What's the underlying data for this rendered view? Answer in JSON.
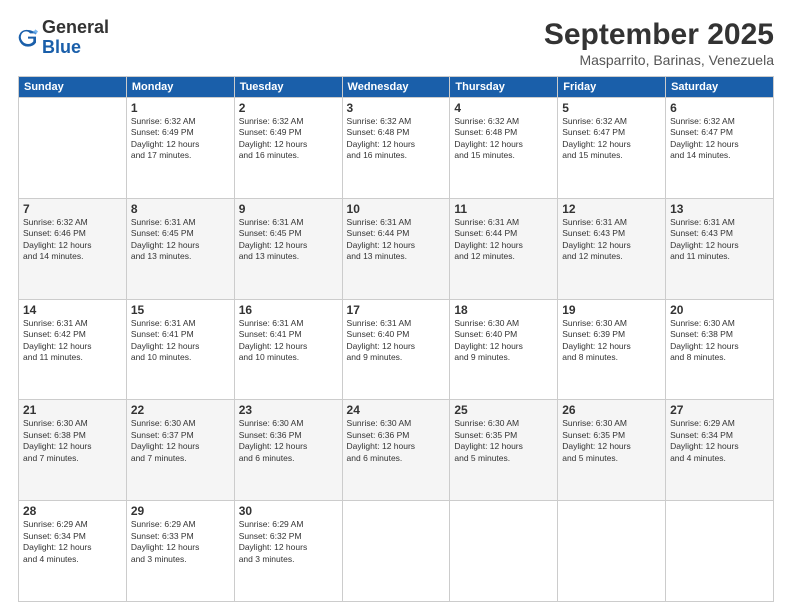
{
  "header": {
    "logo_general": "General",
    "logo_blue": "Blue",
    "month_title": "September 2025",
    "location": "Masparrito, Barinas, Venezuela"
  },
  "days_of_week": [
    "Sunday",
    "Monday",
    "Tuesday",
    "Wednesday",
    "Thursday",
    "Friday",
    "Saturday"
  ],
  "weeks": [
    [
      {
        "day": "",
        "info": ""
      },
      {
        "day": "1",
        "info": "Sunrise: 6:32 AM\nSunset: 6:49 PM\nDaylight: 12 hours\nand 17 minutes."
      },
      {
        "day": "2",
        "info": "Sunrise: 6:32 AM\nSunset: 6:49 PM\nDaylight: 12 hours\nand 16 minutes."
      },
      {
        "day": "3",
        "info": "Sunrise: 6:32 AM\nSunset: 6:48 PM\nDaylight: 12 hours\nand 16 minutes."
      },
      {
        "day": "4",
        "info": "Sunrise: 6:32 AM\nSunset: 6:48 PM\nDaylight: 12 hours\nand 15 minutes."
      },
      {
        "day": "5",
        "info": "Sunrise: 6:32 AM\nSunset: 6:47 PM\nDaylight: 12 hours\nand 15 minutes."
      },
      {
        "day": "6",
        "info": "Sunrise: 6:32 AM\nSunset: 6:47 PM\nDaylight: 12 hours\nand 14 minutes."
      }
    ],
    [
      {
        "day": "7",
        "info": "Sunrise: 6:32 AM\nSunset: 6:46 PM\nDaylight: 12 hours\nand 14 minutes."
      },
      {
        "day": "8",
        "info": "Sunrise: 6:31 AM\nSunset: 6:45 PM\nDaylight: 12 hours\nand 13 minutes."
      },
      {
        "day": "9",
        "info": "Sunrise: 6:31 AM\nSunset: 6:45 PM\nDaylight: 12 hours\nand 13 minutes."
      },
      {
        "day": "10",
        "info": "Sunrise: 6:31 AM\nSunset: 6:44 PM\nDaylight: 12 hours\nand 13 minutes."
      },
      {
        "day": "11",
        "info": "Sunrise: 6:31 AM\nSunset: 6:44 PM\nDaylight: 12 hours\nand 12 minutes."
      },
      {
        "day": "12",
        "info": "Sunrise: 6:31 AM\nSunset: 6:43 PM\nDaylight: 12 hours\nand 12 minutes."
      },
      {
        "day": "13",
        "info": "Sunrise: 6:31 AM\nSunset: 6:43 PM\nDaylight: 12 hours\nand 11 minutes."
      }
    ],
    [
      {
        "day": "14",
        "info": "Sunrise: 6:31 AM\nSunset: 6:42 PM\nDaylight: 12 hours\nand 11 minutes."
      },
      {
        "day": "15",
        "info": "Sunrise: 6:31 AM\nSunset: 6:41 PM\nDaylight: 12 hours\nand 10 minutes."
      },
      {
        "day": "16",
        "info": "Sunrise: 6:31 AM\nSunset: 6:41 PM\nDaylight: 12 hours\nand 10 minutes."
      },
      {
        "day": "17",
        "info": "Sunrise: 6:31 AM\nSunset: 6:40 PM\nDaylight: 12 hours\nand 9 minutes."
      },
      {
        "day": "18",
        "info": "Sunrise: 6:30 AM\nSunset: 6:40 PM\nDaylight: 12 hours\nand 9 minutes."
      },
      {
        "day": "19",
        "info": "Sunrise: 6:30 AM\nSunset: 6:39 PM\nDaylight: 12 hours\nand 8 minutes."
      },
      {
        "day": "20",
        "info": "Sunrise: 6:30 AM\nSunset: 6:38 PM\nDaylight: 12 hours\nand 8 minutes."
      }
    ],
    [
      {
        "day": "21",
        "info": "Sunrise: 6:30 AM\nSunset: 6:38 PM\nDaylight: 12 hours\nand 7 minutes."
      },
      {
        "day": "22",
        "info": "Sunrise: 6:30 AM\nSunset: 6:37 PM\nDaylight: 12 hours\nand 7 minutes."
      },
      {
        "day": "23",
        "info": "Sunrise: 6:30 AM\nSunset: 6:36 PM\nDaylight: 12 hours\nand 6 minutes."
      },
      {
        "day": "24",
        "info": "Sunrise: 6:30 AM\nSunset: 6:36 PM\nDaylight: 12 hours\nand 6 minutes."
      },
      {
        "day": "25",
        "info": "Sunrise: 6:30 AM\nSunset: 6:35 PM\nDaylight: 12 hours\nand 5 minutes."
      },
      {
        "day": "26",
        "info": "Sunrise: 6:30 AM\nSunset: 6:35 PM\nDaylight: 12 hours\nand 5 minutes."
      },
      {
        "day": "27",
        "info": "Sunrise: 6:29 AM\nSunset: 6:34 PM\nDaylight: 12 hours\nand 4 minutes."
      }
    ],
    [
      {
        "day": "28",
        "info": "Sunrise: 6:29 AM\nSunset: 6:34 PM\nDaylight: 12 hours\nand 4 minutes."
      },
      {
        "day": "29",
        "info": "Sunrise: 6:29 AM\nSunset: 6:33 PM\nDaylight: 12 hours\nand 3 minutes."
      },
      {
        "day": "30",
        "info": "Sunrise: 6:29 AM\nSunset: 6:32 PM\nDaylight: 12 hours\nand 3 minutes."
      },
      {
        "day": "",
        "info": ""
      },
      {
        "day": "",
        "info": ""
      },
      {
        "day": "",
        "info": ""
      },
      {
        "day": "",
        "info": ""
      }
    ]
  ]
}
